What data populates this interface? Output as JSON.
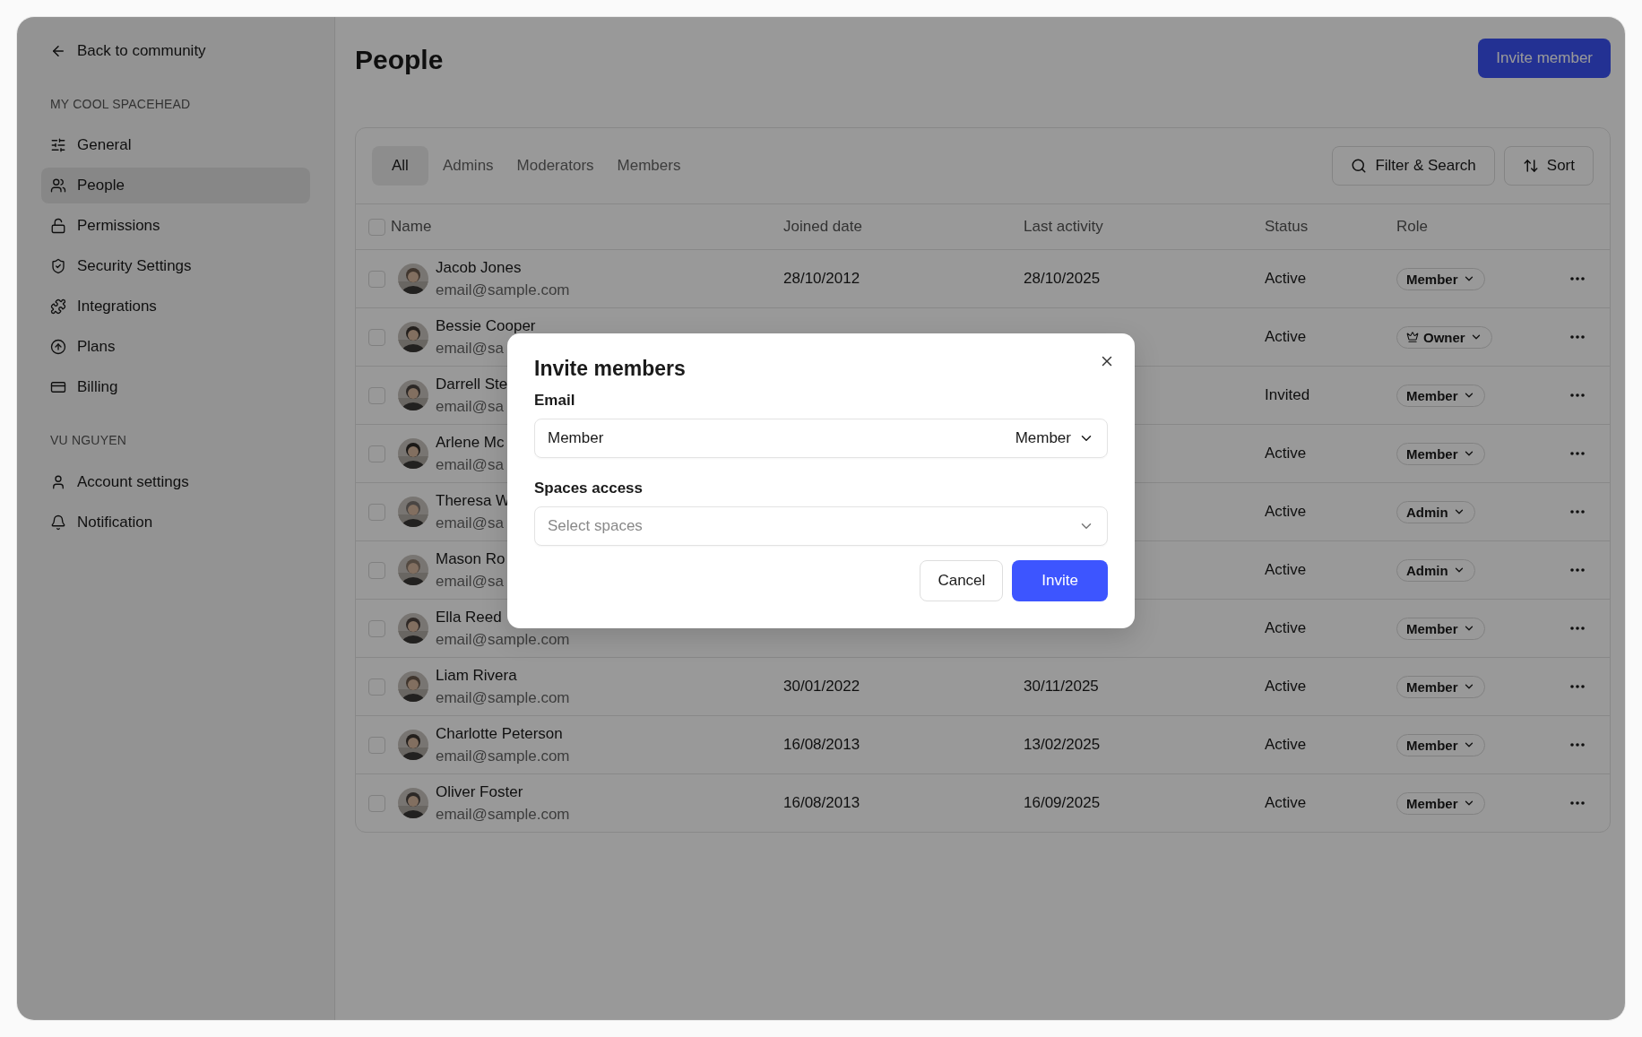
{
  "sidebar": {
    "back_link": "Back to community",
    "sections": [
      {
        "heading": "MY COOL SPACEHEAD",
        "items": [
          {
            "label": "General",
            "selected": false
          },
          {
            "label": "People",
            "selected": true
          },
          {
            "label": "Permissions",
            "selected": false
          },
          {
            "label": "Security Settings",
            "selected": false
          },
          {
            "label": "Integrations",
            "selected": false
          },
          {
            "label": "Plans",
            "selected": false
          },
          {
            "label": "Billing",
            "selected": false
          }
        ]
      },
      {
        "heading": "VU NGUYEN",
        "items": [
          {
            "label": "Account settings",
            "selected": false
          },
          {
            "label": "Notification",
            "selected": false
          }
        ]
      }
    ]
  },
  "header": {
    "title": "People",
    "action": "Invite member"
  },
  "tabs": [
    {
      "label": "All",
      "selected": true
    },
    {
      "label": "Admins",
      "selected": false
    },
    {
      "label": "Moderators",
      "selected": false
    },
    {
      "label": "Members",
      "selected": false
    }
  ],
  "toolbar": {
    "filter": "Filter & Search",
    "sort": "Sort"
  },
  "table": {
    "header_checkbox": {
      "checked": false
    },
    "columns": [
      "Name",
      "Joined date",
      "Last activity",
      "Status",
      "Role"
    ],
    "rows": [
      {
        "checked": false,
        "name": "Jacob Jones",
        "email": "email@sample.com",
        "joined": "28/10/2012",
        "last_activity": "28/10/2025",
        "status": "Active",
        "role": "Member",
        "owner": false
      },
      {
        "checked": false,
        "name": "Bessie Cooper",
        "email": "email@sa",
        "status": "Active",
        "role": "Owner",
        "owner": true
      },
      {
        "checked": false,
        "name": "Darrell Ste",
        "email": "email@sa",
        "status": "Invited",
        "role": "Member",
        "owner": false
      },
      {
        "checked": false,
        "name": "Arlene Mc",
        "email": "email@sa",
        "status": "Active",
        "role": "Member",
        "owner": false
      },
      {
        "checked": false,
        "name": "Theresa W",
        "email": "email@sa",
        "status": "Active",
        "role": "Admin",
        "owner": false
      },
      {
        "checked": false,
        "name": "Mason Ro",
        "email": "email@sa",
        "status": "Active",
        "role": "Admin",
        "owner": false
      },
      {
        "checked": false,
        "name": "Ella Reed",
        "email": "email@sample.com",
        "status": "Active",
        "role": "Member",
        "owner": false
      },
      {
        "checked": false,
        "name": "Liam Rivera",
        "email": "email@sample.com",
        "joined": "30/01/2022",
        "last_activity": "30/11/2025",
        "status": "Active",
        "role": "Member",
        "owner": false
      },
      {
        "checked": false,
        "name": "Charlotte Peterson",
        "email": "email@sample.com",
        "joined": "16/08/2013",
        "last_activity": "13/02/2025",
        "status": "Active",
        "role": "Member",
        "owner": false
      },
      {
        "checked": false,
        "name": "Oliver Foster",
        "email": "email@sample.com",
        "joined": "16/08/2013",
        "last_activity": "16/09/2025",
        "status": "Active",
        "role": "Member",
        "owner": false
      }
    ]
  },
  "modal": {
    "title": "Invite members",
    "email_label": "Email",
    "email_value": "Member",
    "role_select": "Member",
    "spaces_label": "Spaces access",
    "spaces_placeholder": "Select spaces",
    "buttons": [
      {
        "label": "Cancel",
        "kind": "secondary"
      },
      {
        "label": "Invite",
        "kind": "primary"
      }
    ]
  }
}
